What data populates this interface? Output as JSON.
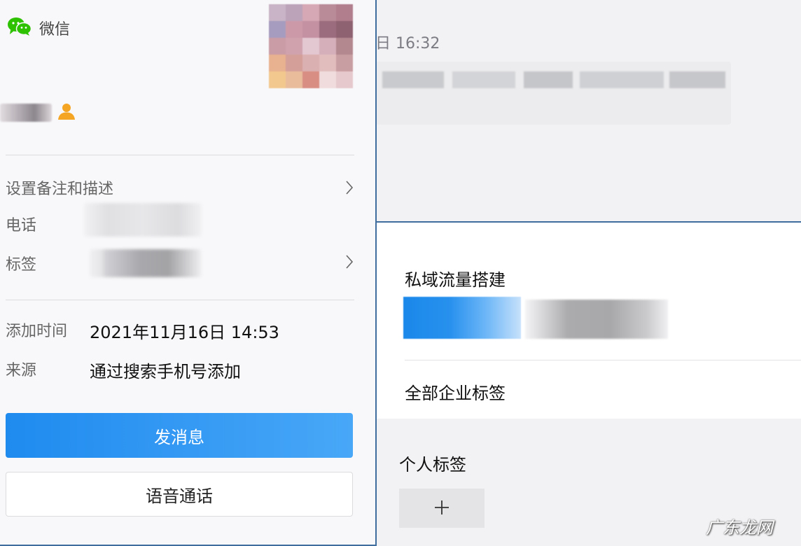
{
  "app": {
    "name": "微信"
  },
  "chat": {
    "timestamp": "日 16:32"
  },
  "profile": {
    "rows": {
      "remark": {
        "label": "设置备注和描述"
      },
      "phone": {
        "label": "电话"
      },
      "tags": {
        "label": "标签"
      },
      "added_time": {
        "label": "添加时间",
        "value": "2021年11月16日 14:53"
      },
      "source": {
        "label": "来源",
        "value": "通过搜索手机号添加"
      }
    },
    "buttons": {
      "send_message": "发消息",
      "voice_call": "语音通话"
    }
  },
  "tag_popup": {
    "group_title": "私域流量搭建",
    "all_corp_tags": "全部企业标签",
    "personal_tags_title": "个人标签",
    "add_symbol": "+"
  },
  "watermark": "广东龙网",
  "colors": {
    "primary_blue": "#2b95f0",
    "wechat_green": "#2dc100",
    "person_icon_orange": "#f5a524",
    "panel_border": "#3f6e9e"
  },
  "icons": {
    "brand": "wechat-logo-icon",
    "contact": "person-icon",
    "chevron": "chevron-right-icon",
    "add": "plus-icon"
  }
}
